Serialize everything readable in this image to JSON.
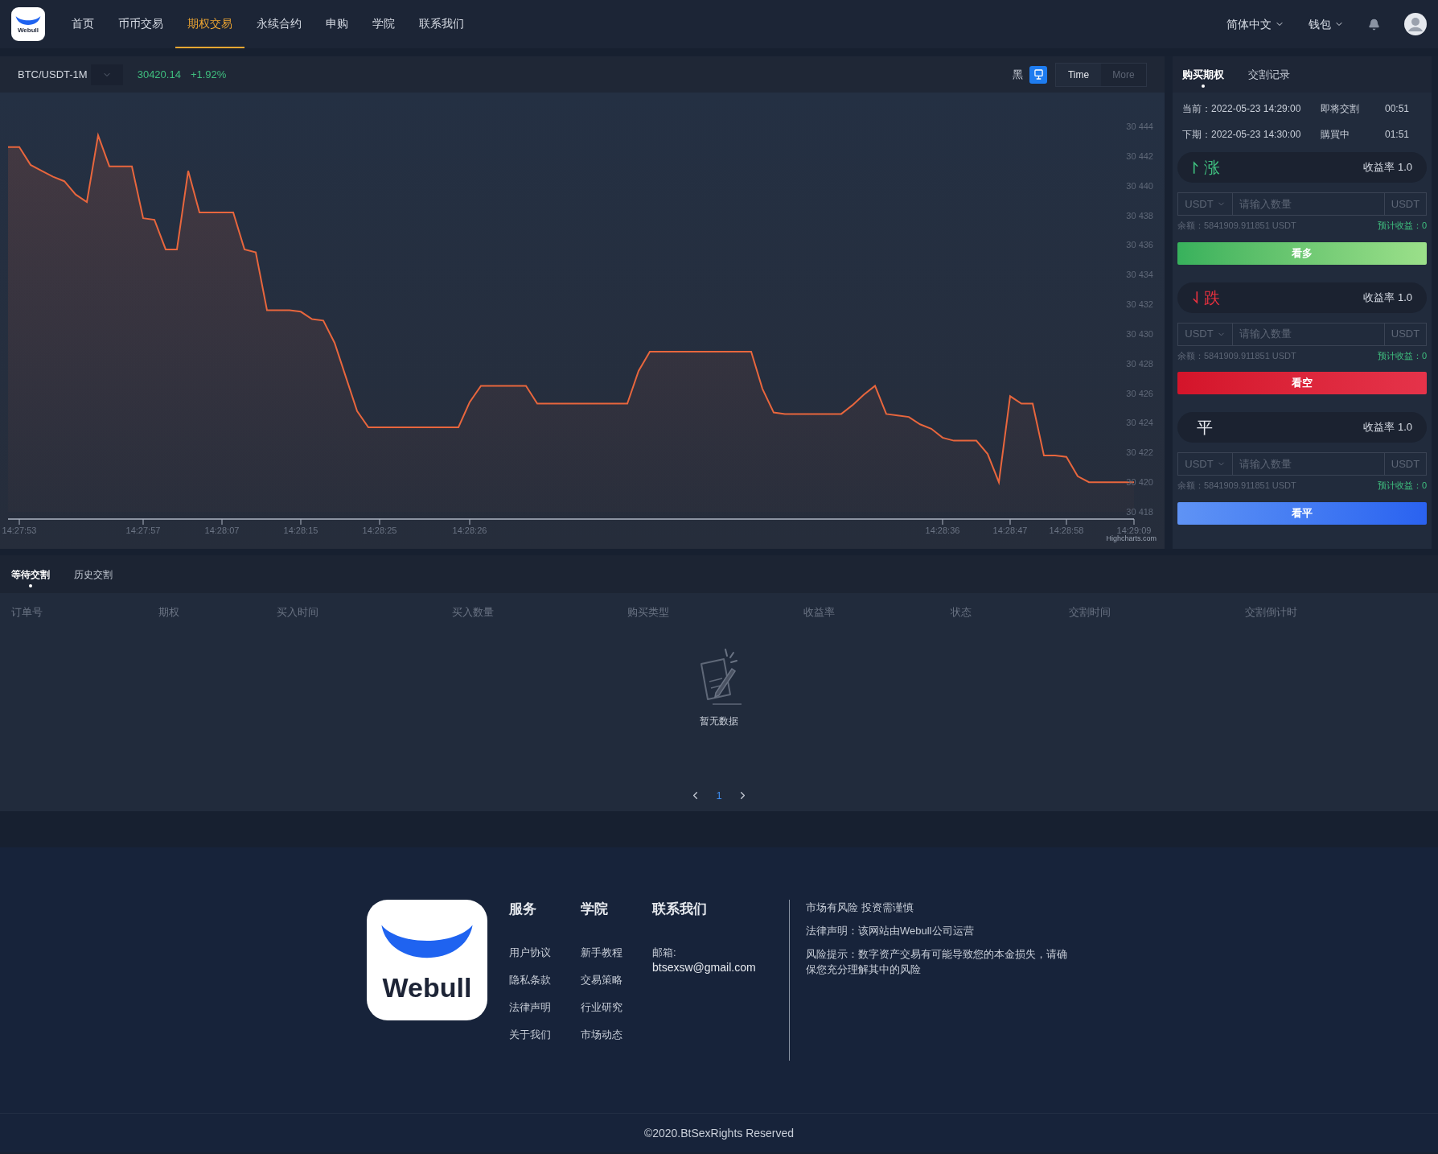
{
  "header": {
    "logo_text": "Webull",
    "nav": [
      {
        "label": "首页",
        "selected": false
      },
      {
        "label": "币币交易",
        "selected": false
      },
      {
        "label": "期权交易",
        "selected": true
      },
      {
        "label": "永续合约",
        "selected": false
      },
      {
        "label": "申购",
        "selected": false
      },
      {
        "label": "学院",
        "selected": false
      },
      {
        "label": "联系我们",
        "selected": false
      }
    ],
    "language": "简体中文",
    "wallet": "钱包"
  },
  "chart_panel": {
    "symbol": "BTC/USDT-1M",
    "price": "30420.14",
    "change": "+1.92%",
    "theme_label": "黑",
    "theme_toggle_on": true,
    "view_buttons": [
      {
        "label": "Time",
        "selected": true
      },
      {
        "label": "More",
        "selected": false
      }
    ],
    "credit": "Highcharts.com",
    "chart_data": {
      "type": "area",
      "categories": [
        null,
        "14:27:53",
        null,
        null,
        null,
        null,
        null,
        null,
        null,
        null,
        null,
        null,
        "14:27:57",
        null,
        null,
        null,
        null,
        null,
        null,
        "14:28:07",
        null,
        null,
        null,
        null,
        null,
        null,
        "14:28:15",
        null,
        null,
        null,
        null,
        null,
        null,
        "14:28:25",
        null,
        null,
        null,
        null,
        null,
        null,
        null,
        "14:28:26",
        null,
        null,
        null,
        null,
        null,
        null,
        null,
        null,
        null,
        null,
        null,
        null,
        null,
        null,
        null,
        null,
        null,
        null,
        null,
        null,
        null,
        null,
        null,
        null,
        null,
        null,
        null,
        null,
        null,
        null,
        null,
        null,
        null,
        null,
        null,
        null,
        null,
        null,
        null,
        null,
        null,
        "14:28:36",
        null,
        null,
        null,
        null,
        null,
        "14:28:47",
        null,
        null,
        null,
        null,
        "14:28:58",
        null,
        null,
        null,
        null,
        null,
        "14:29:09"
      ],
      "series": [
        {
          "color": "#e8663d",
          "values": [
            30442.6,
            30442.6,
            30441.4,
            30441.0,
            30440.6,
            30440.3,
            30439.4,
            30438.9,
            30443.4,
            30441.3,
            30441.3,
            30441.3,
            30437.8,
            30437.7,
            30435.7,
            30435.7,
            30441.0,
            30438.2,
            30438.2,
            30438.2,
            30438.2,
            30435.7,
            30435.5,
            30431.6,
            30431.6,
            30431.6,
            30431.5,
            30431.0,
            30430.9,
            30429.4,
            30427.1,
            30424.8,
            30423.7,
            30423.7,
            30423.7,
            30423.7,
            30423.7,
            30423.7,
            30423.7,
            30423.7,
            30423.7,
            30425.4,
            30426.5,
            30426.5,
            30426.5,
            30426.5,
            30426.5,
            30425.3,
            30425.3,
            30425.3,
            30425.3,
            30425.3,
            30425.3,
            30425.3,
            30425.3,
            30425.3,
            30427.5,
            30428.8,
            30428.8,
            30428.8,
            30428.8,
            30428.8,
            30428.8,
            30428.8,
            30428.8,
            30428.8,
            30428.8,
            30426.3,
            30424.7,
            30424.6,
            30424.6,
            30424.6,
            30424.6,
            30424.6,
            30424.6,
            30425.2,
            30425.9,
            30426.5,
            30424.6,
            30424.5,
            30424.4,
            30423.9,
            30423.6,
            30423.0,
            30422.8,
            30422.8,
            30422.8,
            30421.9,
            30420.0,
            30425.8,
            30425.3,
            30425.3,
            30421.8,
            30421.8,
            30421.7,
            30420.4,
            30420.0,
            30420.0,
            30420.0,
            30420.0,
            30420.0
          ]
        }
      ],
      "ylim": [
        30418,
        30444
      ],
      "yticks": [
        {
          "value": 30418,
          "label": "30 418"
        },
        {
          "value": 30420,
          "label": "30 420"
        },
        {
          "value": 30422,
          "label": "30 422"
        },
        {
          "value": 30424,
          "label": "30 424"
        },
        {
          "value": 30426,
          "label": "30 426"
        },
        {
          "value": 30428,
          "label": "30 428"
        },
        {
          "value": 30430,
          "label": "30 430"
        },
        {
          "value": 30432,
          "label": "30 432"
        },
        {
          "value": 30434,
          "label": "30 434"
        },
        {
          "value": 30436,
          "label": "30 436"
        },
        {
          "value": 30438,
          "label": "30 438"
        },
        {
          "value": 30440,
          "label": "30 440"
        },
        {
          "value": 30442,
          "label": "30 442"
        },
        {
          "value": 30444,
          "label": "30 444"
        }
      ]
    }
  },
  "trade_panel": {
    "tabs": [
      {
        "label": "购买期权",
        "selected": true
      },
      {
        "label": "交割记录",
        "selected": false
      }
    ],
    "periods": [
      {
        "label": "当前：",
        "time": "2022-05-23 14:29:00",
        "status": "即将交割",
        "countdown": "00:51"
      },
      {
        "label": "下期：",
        "time": "2022-05-23 14:30:00",
        "status": "購買中",
        "countdown": "01:51"
      }
    ],
    "options": [
      {
        "kind": "up",
        "label": "涨",
        "rate": "收益率 1.0",
        "currency": "USDT",
        "placeholder": "请输入数量",
        "unit": "USDT",
        "balance": "余额：5841909.911851 USDT",
        "estimate": "预计收益：0",
        "button": "看多"
      },
      {
        "kind": "down",
        "label": "跌",
        "rate": "收益率 1.0",
        "currency": "USDT",
        "placeholder": "请输入数量",
        "unit": "USDT",
        "balance": "余额：5841909.911851 USDT",
        "estimate": "预计收益：0",
        "button": "看空"
      },
      {
        "kind": "flat",
        "label": "平",
        "rate": "收益率 1.0",
        "currency": "USDT",
        "placeholder": "请输入数量",
        "unit": "USDT",
        "balance": "余额：5841909.911851 USDT",
        "estimate": "预计收益：0",
        "button": "看平"
      }
    ]
  },
  "orders": {
    "tabs": [
      {
        "label": "等待交割",
        "selected": true
      },
      {
        "label": "历史交割",
        "selected": false
      }
    ],
    "columns": [
      "订单号",
      "期权",
      "买入时间",
      "买入数量",
      "购买类型",
      "收益率",
      "状态",
      "交割时间",
      "交割倒计时"
    ],
    "empty_text": "暂无数据",
    "pages": [
      {
        "label": "1",
        "selected": true
      }
    ]
  },
  "footer": {
    "logo_text": "Webull",
    "columns": [
      {
        "title": "服务",
        "links": [
          "用户协议",
          "隐私条款",
          "法律声明",
          "关于我们"
        ]
      },
      {
        "title": "学院",
        "links": [
          "新手教程",
          "交易策略",
          "行业研究",
          "市场动态"
        ]
      }
    ],
    "contact": {
      "title": "联系我们",
      "email_label": "邮箱:",
      "email": "btsexsw@gmail.com"
    },
    "notices": [
      "市场有风险 投资需谨慎",
      "法律声明：该网站由Webull公司运营",
      "风险提示：数字资产交易有可能导致您的本金损失，请确保您充分理解其中的风险"
    ],
    "copyright": "©2020.BtSexRights Reserved"
  }
}
